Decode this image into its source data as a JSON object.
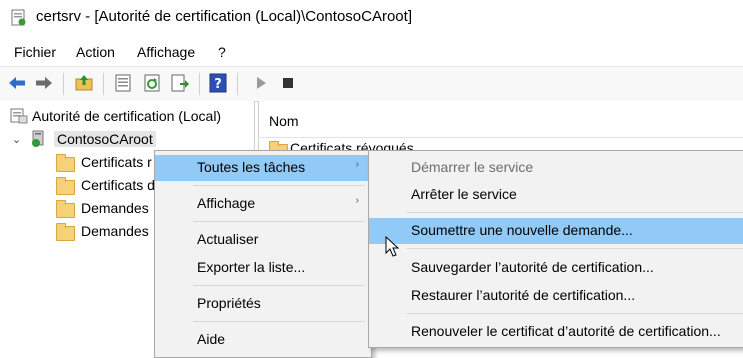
{
  "window": {
    "title": "certsrv - [Autorité de certification (Local)\\ContosoCAroot]"
  },
  "menubar": {
    "items": [
      "Fichier",
      "Action",
      "Affichage",
      "?"
    ]
  },
  "toolbar": {
    "icons": [
      "back-arrow-icon",
      "forward-arrow-icon",
      "up-folder-icon",
      "properties-icon",
      "refresh-icon",
      "export-list-icon",
      "help-icon",
      "play-icon",
      "stop-icon"
    ]
  },
  "tree": {
    "root": "Autorité de certification (Local)",
    "ca": "ContosoCAroot",
    "children": [
      "Certificats r",
      "Certificats d",
      "Demandes",
      "Demandes"
    ]
  },
  "list": {
    "column": "Nom",
    "items": [
      "Certificats révoqués"
    ]
  },
  "context_menu": {
    "items": [
      {
        "label": "Toutes les tâches",
        "submenu_arrow": "›"
      },
      {
        "label": "Affichage",
        "submenu_arrow": "›"
      },
      {
        "label": "Actualiser"
      },
      {
        "label": "Exporter la liste..."
      },
      {
        "label": "Propriétés"
      },
      {
        "label": "Aide"
      }
    ]
  },
  "submenu": {
    "items": [
      {
        "label": "Démarrer le service",
        "state": "disabled"
      },
      {
        "label": "Arrêter le service"
      },
      {
        "label": "Soumettre une nouvelle demande...",
        "state": "highlighted"
      },
      {
        "label": "Sauvegarder l’autorité de certification..."
      },
      {
        "label": "Restaurer l’autorité de certification..."
      },
      {
        "label": "Renouveler le certificat d’autorité de certification..."
      }
    ]
  },
  "colors": {
    "highlight": "#91c9f7",
    "menu_bg": "#f2f2f2",
    "folder": "#f5d27a"
  }
}
